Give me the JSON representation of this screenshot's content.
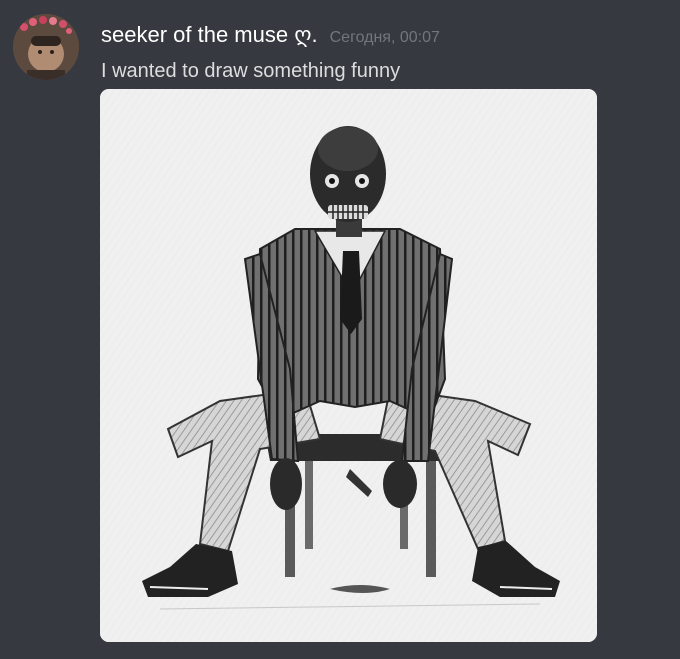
{
  "message": {
    "author": {
      "username": "seeker of the muse ღ.",
      "avatar_icon": "user-avatar-icon"
    },
    "timestamp": "Сегодня, 00:07",
    "text": "I wanted to draw something funny",
    "attachment": {
      "type": "image",
      "description_icon": "pencil-sketch-image"
    }
  },
  "colors": {
    "background": "#36393f",
    "username": "#ffffff",
    "timestamp": "#72767d",
    "message_text": "#dcddde"
  }
}
